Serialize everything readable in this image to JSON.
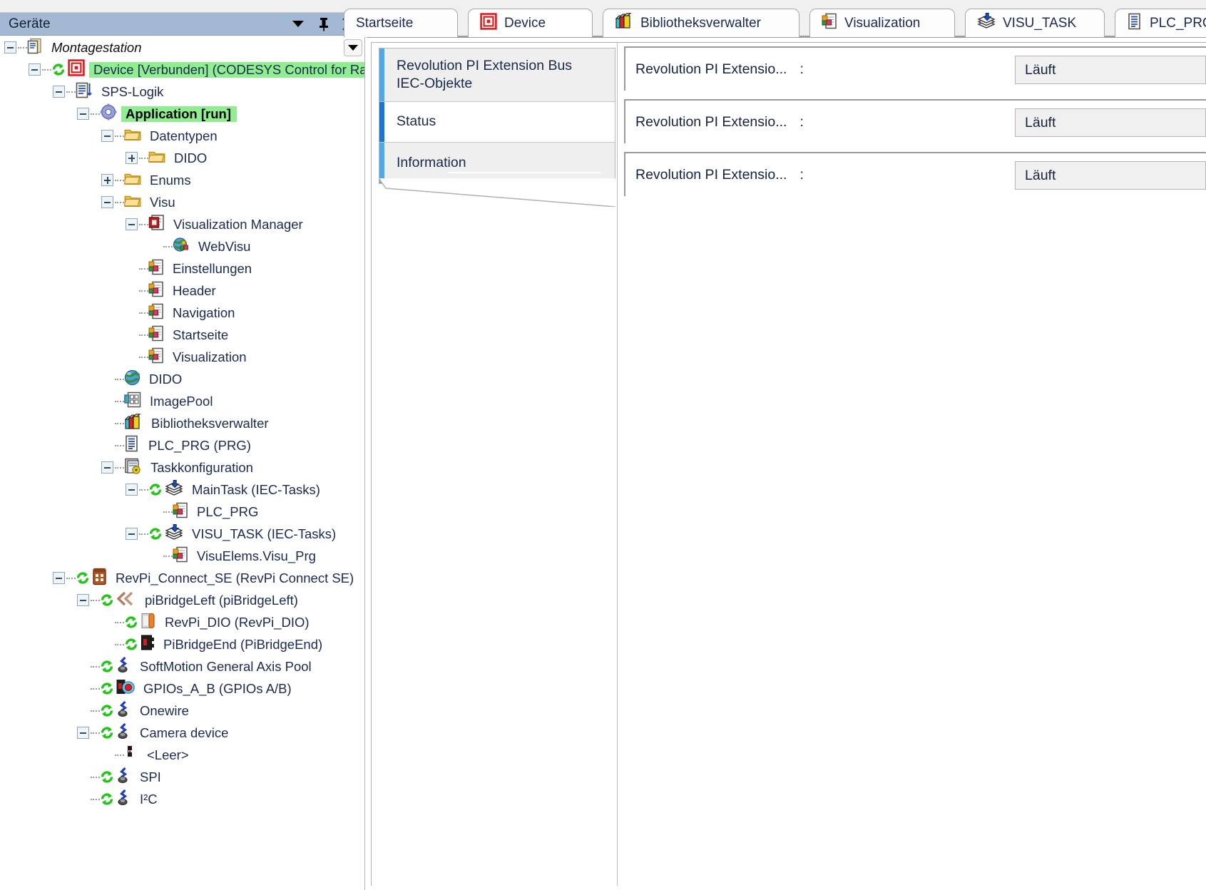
{
  "devices_panel": {
    "title": "Geräte",
    "header_buttons": [
      {
        "name": "dropdown-caret",
        "icon": "chevron-down-icon"
      },
      {
        "name": "pin",
        "icon": "pin-icon",
        "glyph": "▮"
      },
      {
        "name": "close",
        "icon": "close-icon",
        "glyph": "✕"
      }
    ],
    "tree": [
      {
        "label": "Montagestation",
        "depth": 0,
        "expander": "minus",
        "icon": "project-icon",
        "style": "italic",
        "highlight": false,
        "online": false
      },
      {
        "label": "Device [Verbunden] (CODESYS Control for Raspb",
        "depth": 1,
        "expander": "minus",
        "icon": "device-icon",
        "style": "normal",
        "highlight": true,
        "online": true
      },
      {
        "label": "SPS-Logik",
        "depth": 2,
        "expander": "minus",
        "icon": "plc-logic-icon",
        "style": "normal",
        "highlight": false,
        "online": false
      },
      {
        "label": "Application [run]",
        "depth": 3,
        "expander": "minus",
        "icon": "application-icon",
        "style": "bold",
        "highlight": true,
        "online": false
      },
      {
        "label": "Datentypen",
        "depth": 4,
        "expander": "minus",
        "icon": "folder-icon",
        "style": "normal",
        "highlight": false,
        "online": false
      },
      {
        "label": "DIDO",
        "depth": 5,
        "expander": "plus",
        "icon": "folder-icon",
        "style": "normal",
        "highlight": false,
        "online": false
      },
      {
        "label": "Enums",
        "depth": 4,
        "expander": "plus",
        "icon": "folder-icon",
        "style": "normal",
        "highlight": false,
        "online": false
      },
      {
        "label": "Visu",
        "depth": 4,
        "expander": "minus",
        "icon": "folder-icon",
        "style": "normal",
        "highlight": false,
        "online": false
      },
      {
        "label": "Visualization Manager",
        "depth": 5,
        "expander": "minus",
        "icon": "visualization-manager-icon",
        "style": "normal",
        "highlight": false,
        "online": false
      },
      {
        "label": "WebVisu",
        "depth": 6,
        "expander": "none",
        "icon": "webvisu-icon",
        "style": "normal",
        "highlight": false,
        "online": false
      },
      {
        "label": "Einstellungen",
        "depth": 5,
        "expander": "none",
        "icon": "visu-page-icon",
        "style": "normal",
        "highlight": false,
        "online": false
      },
      {
        "label": "Header",
        "depth": 5,
        "expander": "none",
        "icon": "visu-page-icon",
        "style": "normal",
        "highlight": false,
        "online": false
      },
      {
        "label": "Navigation",
        "depth": 5,
        "expander": "none",
        "icon": "visu-page-icon",
        "style": "normal",
        "highlight": false,
        "online": false
      },
      {
        "label": "Startseite",
        "depth": 5,
        "expander": "none",
        "icon": "visu-page-icon",
        "style": "normal",
        "highlight": false,
        "online": false
      },
      {
        "label": "Visualization",
        "depth": 5,
        "expander": "none",
        "icon": "visu-page-icon",
        "style": "normal",
        "highlight": false,
        "online": false
      },
      {
        "label": "DIDO",
        "depth": 4,
        "expander": "none",
        "icon": "globe-icon",
        "style": "normal",
        "highlight": false,
        "online": false
      },
      {
        "label": "ImagePool",
        "depth": 4,
        "expander": "none",
        "icon": "imagepool-icon",
        "style": "normal",
        "highlight": false,
        "online": false
      },
      {
        "label": "Bibliotheksverwalter",
        "depth": 4,
        "expander": "none",
        "icon": "library-icon",
        "style": "normal",
        "highlight": false,
        "online": false
      },
      {
        "label": "PLC_PRG (PRG)",
        "depth": 4,
        "expander": "none",
        "icon": "program-icon",
        "style": "normal",
        "highlight": false,
        "online": false
      },
      {
        "label": "Taskkonfiguration",
        "depth": 4,
        "expander": "minus",
        "icon": "task-config-icon",
        "style": "normal",
        "highlight": false,
        "online": false
      },
      {
        "label": "MainTask (IEC-Tasks)",
        "depth": 5,
        "expander": "minus",
        "icon": "task-icon",
        "style": "normal",
        "highlight": false,
        "online": true
      },
      {
        "label": "PLC_PRG",
        "depth": 6,
        "expander": "none",
        "icon": "visu-page-icon",
        "style": "normal",
        "highlight": false,
        "online": false
      },
      {
        "label": "VISU_TASK (IEC-Tasks)",
        "depth": 5,
        "expander": "minus",
        "icon": "task-icon",
        "style": "normal",
        "highlight": false,
        "online": true
      },
      {
        "label": "VisuElems.Visu_Prg",
        "depth": 6,
        "expander": "none",
        "icon": "visu-page-icon",
        "style": "normal",
        "highlight": false,
        "online": false
      },
      {
        "label": "RevPi_Connect_SE (RevPi Connect SE)",
        "depth": 2,
        "expander": "minus",
        "icon": "revpi-icon",
        "style": "normal",
        "highlight": false,
        "online": true
      },
      {
        "label": "piBridgeLeft (piBridgeLeft)",
        "depth": 3,
        "expander": "minus",
        "icon": "pibridge-left-icon",
        "style": "normal",
        "highlight": false,
        "online": true
      },
      {
        "label": "RevPi_DIO (RevPi_DIO)",
        "depth": 4,
        "expander": "none",
        "icon": "revpi-dio-icon",
        "style": "normal",
        "highlight": false,
        "online": true
      },
      {
        "label": "PiBridgeEnd (PiBridgeEnd)",
        "depth": 4,
        "expander": "none",
        "icon": "pibridge-end-icon",
        "style": "normal",
        "highlight": false,
        "online": true
      },
      {
        "label": "SoftMotion General Axis Pool",
        "depth": 3,
        "expander": "none",
        "icon": "axis-pool-icon",
        "style": "normal",
        "highlight": false,
        "online": true
      },
      {
        "label": "GPIOs_A_B (GPIOs A/B)",
        "depth": 3,
        "expander": "none",
        "icon": "gpio-icon",
        "style": "normal",
        "highlight": false,
        "online": true
      },
      {
        "label": "Onewire",
        "depth": 3,
        "expander": "none",
        "icon": "axis-pool-icon",
        "style": "normal",
        "highlight": false,
        "online": true
      },
      {
        "label": "Camera device",
        "depth": 3,
        "expander": "minus",
        "icon": "axis-pool-icon",
        "style": "normal",
        "highlight": false,
        "online": true
      },
      {
        "label": "<Leer>",
        "depth": 4,
        "expander": "none",
        "icon": "empty-slot-icon",
        "style": "normal",
        "highlight": false,
        "online": false
      },
      {
        "label": "SPI",
        "depth": 3,
        "expander": "none",
        "icon": "axis-pool-icon",
        "style": "normal",
        "highlight": false,
        "online": true
      },
      {
        "label": "I²C",
        "depth": 3,
        "expander": "none",
        "icon": "axis-pool-icon",
        "style": "normal",
        "highlight": false,
        "online": true
      }
    ]
  },
  "tabs": [
    {
      "label": "Startseite",
      "icon": "none",
      "active": false
    },
    {
      "label": "Device",
      "icon": "device-icon",
      "active": true
    },
    {
      "label": "Bibliotheksverwalter",
      "icon": "library-icon",
      "active": false
    },
    {
      "label": "Visualization",
      "icon": "visu-page-icon",
      "active": false
    },
    {
      "label": "VISU_TASK",
      "icon": "task-icon",
      "active": false
    },
    {
      "label": "PLC_PRG",
      "icon": "program-icon",
      "active": false
    }
  ],
  "editor": {
    "nav_items": [
      {
        "label": "Revolution PI Extension Bus IEC-Objekte",
        "active": false
      },
      {
        "label": "Status",
        "active": true
      },
      {
        "label": "Information",
        "active": false
      }
    ],
    "status_rows": [
      {
        "label": "Revolution PI Extensio...",
        "separator": ":",
        "value": "Läuft"
      },
      {
        "label": "Revolution PI Extensio...",
        "separator": ":",
        "value": "Läuft"
      },
      {
        "label": "Revolution PI Extensio...",
        "separator": ":",
        "value": "Läuft"
      }
    ]
  },
  "colors": {
    "panel_header": "#a3b8d2",
    "highlight_green": "#90ee90",
    "nav_bar_inactive": "#4fa8e8",
    "nav_bar_active": "#1878cf",
    "tree_text": "#1a2a52"
  }
}
